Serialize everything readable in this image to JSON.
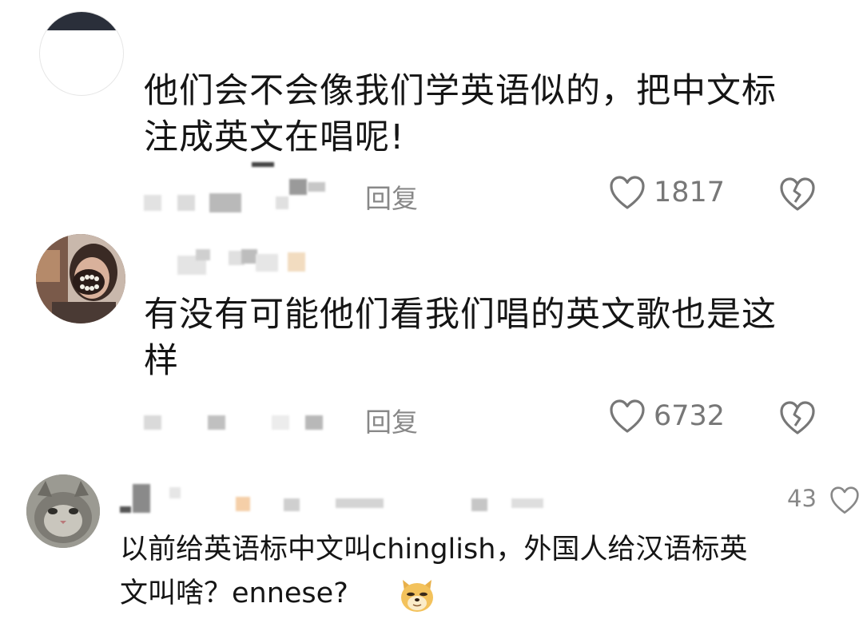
{
  "comments": [
    {
      "text_line1": "他们会不会像我们学英语似的，把中文标",
      "text_line2": "注成英文在唱呢!",
      "reply_label": "回复",
      "likes": "1817",
      "like_icon": "heart-outline-icon",
      "dislike_icon": "broken-heart-icon"
    },
    {
      "text_line1": "有没有可能他们看我们唱的英文歌也是这",
      "text_line2": "样",
      "reply_label": "回复",
      "likes": "6732",
      "like_icon": "heart-outline-icon",
      "dislike_icon": "broken-heart-icon"
    },
    {
      "text_line1": "以前给英语标中文叫chinglish，外国人给汉语标英",
      "text_line2": "文叫啥？ennese?",
      "emoji": "doge-emoji",
      "likes": "43",
      "like_icon": "heart-outline-icon"
    }
  ],
  "colors": {
    "text": "#151515",
    "meta": "#888888",
    "background": "#ffffff"
  }
}
